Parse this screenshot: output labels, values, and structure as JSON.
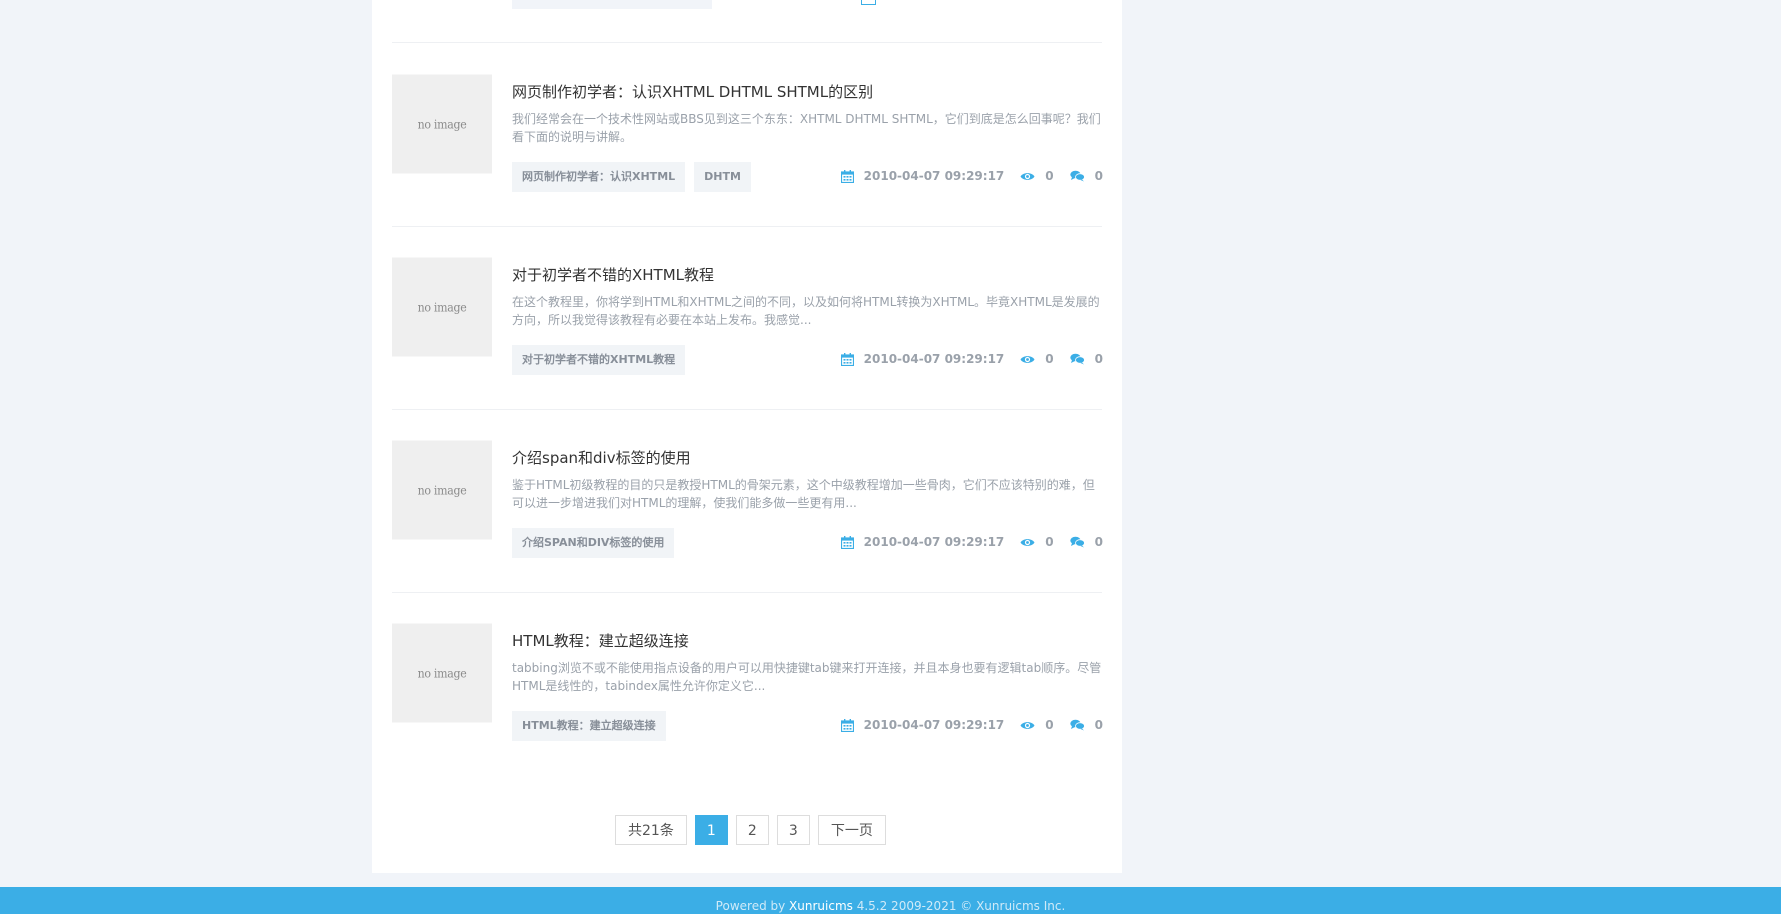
{
  "articles": [
    {
      "thumb_text": "no image",
      "title": "网页制作初学者：认识XHTML DHTML SHTML的区别",
      "excerpt": "我们经常会在一个技术性网站或BBS见到这三个东东：XHTML DHTML SHTML，它们到底是怎么回事呢？我们看下面的说明与讲解。",
      "tags": [
        "网页制作初学者：认识XHTML",
        "DHTM"
      ],
      "date": "2010-04-07 09:29:17",
      "views": "0",
      "comments": "0"
    },
    {
      "thumb_text": "no image",
      "title": "对于初学者不错的XHTML教程",
      "excerpt": "在这个教程里，你将学到HTML和XHTML之间的不同，以及如何将HTML转换为XHTML。毕竟XHTML是发展的方向，所以我觉得该教程有必要在本站上发布。我感觉...",
      "tags": [
        "对于初学者不错的XHTML教程"
      ],
      "date": "2010-04-07 09:29:17",
      "views": "0",
      "comments": "0"
    },
    {
      "thumb_text": "no image",
      "title": "介绍span和div标签的使用",
      "excerpt": "鉴于HTML初级教程的目的只是教授HTML的骨架元素，这个中级教程增加一些骨肉，它们不应该特别的难，但可以进一步增进我们对HTML的理解，使我们能多做一些更有用...",
      "tags": [
        "介绍SPAN和DIV标签的使用"
      ],
      "date": "2010-04-07 09:29:17",
      "views": "0",
      "comments": "0"
    },
    {
      "thumb_text": "no image",
      "title": "HTML教程：建立超级连接",
      "excerpt": "tabbing浏览不或不能使用指点设备的用户可以用快捷键tab键来打开连接，并且本身也要有逻辑tab顺序。尽管HTML是线性的，tabindex属性允许你定义它...",
      "tags": [
        "HTML教程：建立超级连接"
      ],
      "date": "2010-04-07 09:29:17",
      "views": "0",
      "comments": "0"
    }
  ],
  "pagination": {
    "total": "共21条",
    "pages": [
      "1",
      "2",
      "3"
    ],
    "current": "1",
    "next": "下一页"
  },
  "footer": {
    "prefix": "Powered by ",
    "brand": "Xunruicms",
    "suffix": " 4.5.2 2009-2021 © Xunruicms Inc."
  },
  "colors": {
    "accent": "#3baee6",
    "background": "#f1f4f9"
  }
}
